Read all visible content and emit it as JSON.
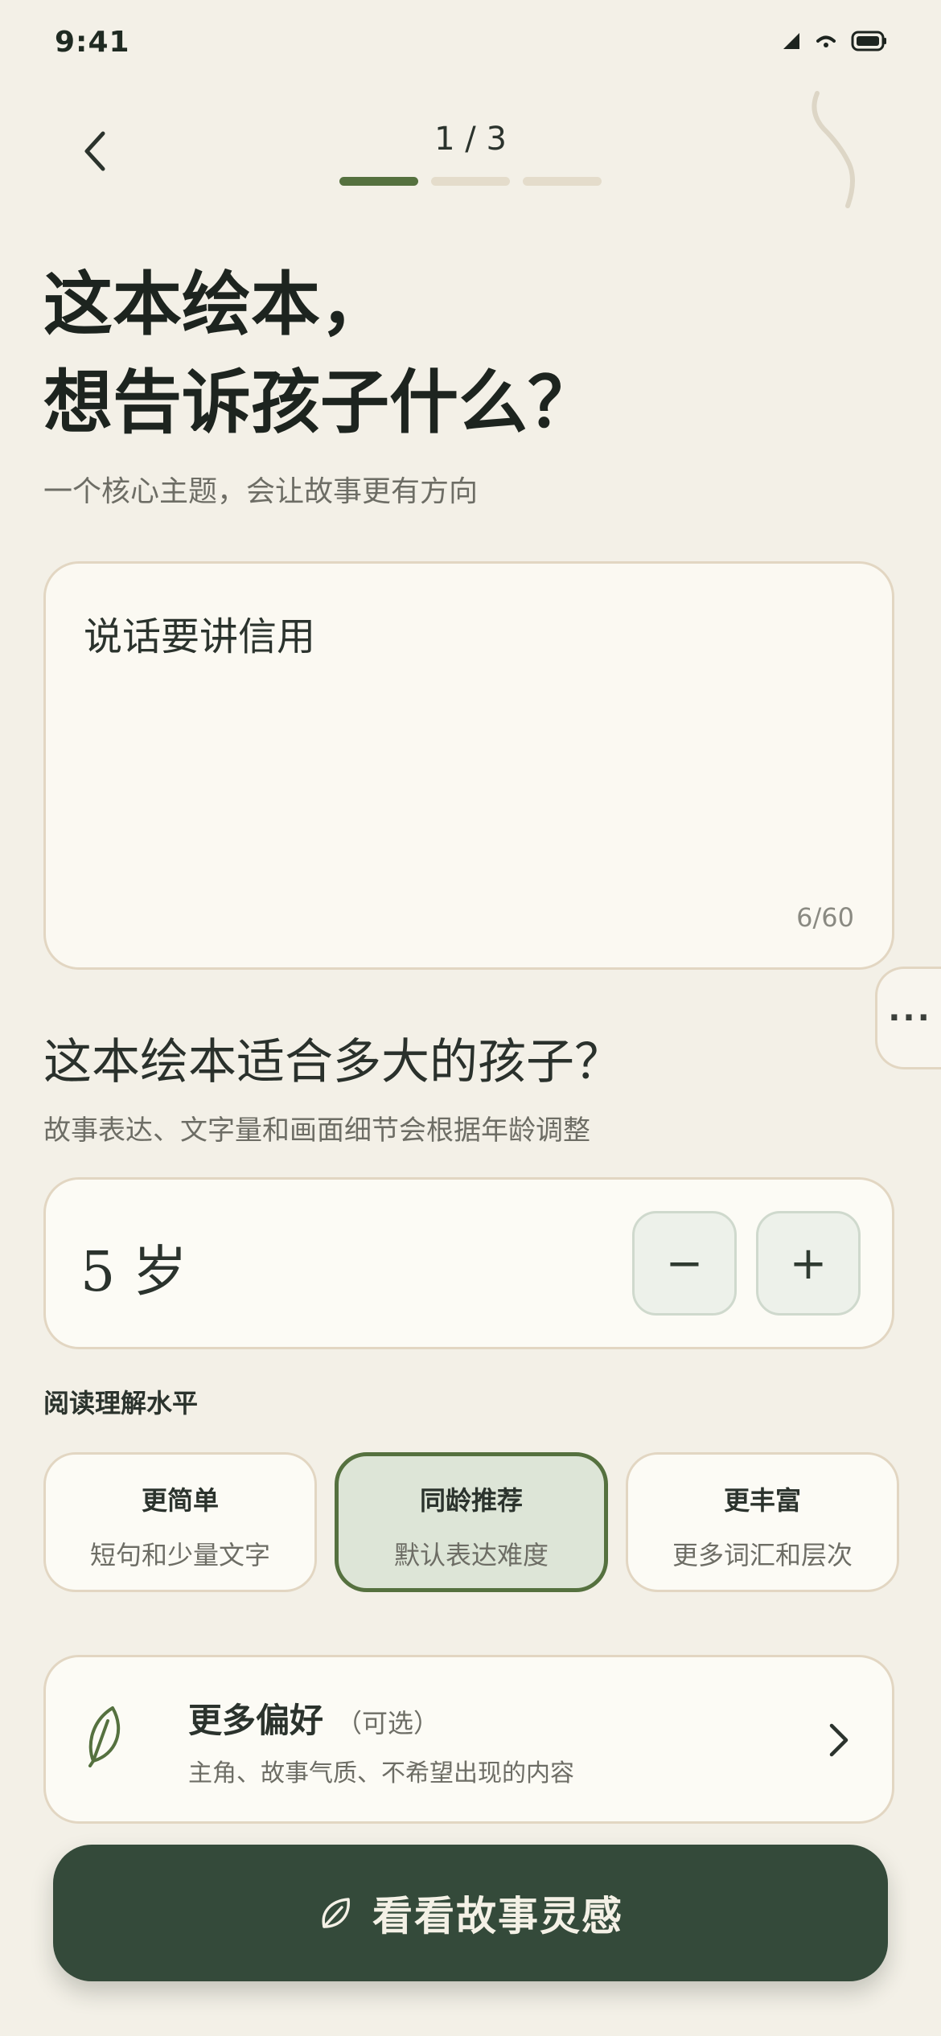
{
  "status_bar": {
    "time": "9:41"
  },
  "header": {
    "step": "1 / 3",
    "progress": {
      "current": 1,
      "total": 3
    }
  },
  "title": {
    "line1": "这本绘本，",
    "line2": "想告诉孩子什么？",
    "subtitle": "一个核心主题，会让故事更有方向"
  },
  "topic": {
    "value": "说话要讲信用",
    "counter": "6/60"
  },
  "age": {
    "title": "这本绘本适合多大的孩子？",
    "subtitle": "故事表达、文字量和画面细节会根据年龄调整",
    "value": "5 岁",
    "minus": "−",
    "plus": "+"
  },
  "reading_level": {
    "label": "阅读理解水平",
    "options": [
      {
        "title": "更简单",
        "desc": "短句和少量文字",
        "selected": false
      },
      {
        "title": "同龄推荐",
        "desc": "默认表达难度",
        "selected": true
      },
      {
        "title": "更丰富",
        "desc": "更多词汇和层次",
        "selected": false
      }
    ]
  },
  "preferences": {
    "title": "更多偏好",
    "optional": "（可选）",
    "subtitle": "主角、故事气质、不希望出现的内容",
    "icon": "leaf-icon"
  },
  "cta": {
    "label": "看看故事灵感",
    "icon": "leaf-icon"
  },
  "more_handle": {
    "label": "···"
  },
  "colors": {
    "accent": "#55713f",
    "cta_bg": "#344a3a",
    "background": "#f3f0e7",
    "card_border": "#e2d6c2"
  }
}
